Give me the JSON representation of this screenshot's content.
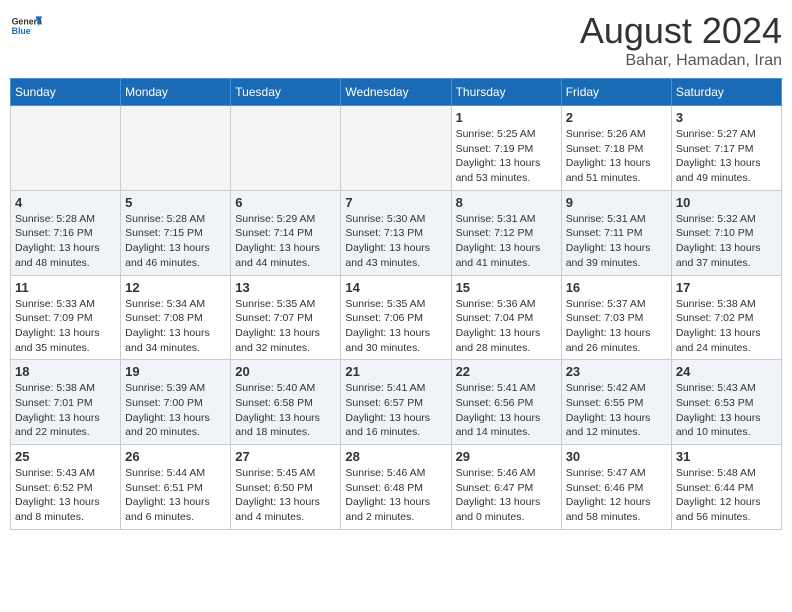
{
  "header": {
    "logo_general": "General",
    "logo_blue": "Blue",
    "month_title": "August 2024",
    "location": "Bahar, Hamadan, Iran"
  },
  "weekdays": [
    "Sunday",
    "Monday",
    "Tuesday",
    "Wednesday",
    "Thursday",
    "Friday",
    "Saturday"
  ],
  "weeks": [
    {
      "days": [
        {
          "num": "",
          "info": ""
        },
        {
          "num": "",
          "info": ""
        },
        {
          "num": "",
          "info": ""
        },
        {
          "num": "",
          "info": ""
        },
        {
          "num": "1",
          "info": "Sunrise: 5:25 AM\nSunset: 7:19 PM\nDaylight: 13 hours\nand 53 minutes."
        },
        {
          "num": "2",
          "info": "Sunrise: 5:26 AM\nSunset: 7:18 PM\nDaylight: 13 hours\nand 51 minutes."
        },
        {
          "num": "3",
          "info": "Sunrise: 5:27 AM\nSunset: 7:17 PM\nDaylight: 13 hours\nand 49 minutes."
        }
      ]
    },
    {
      "days": [
        {
          "num": "4",
          "info": "Sunrise: 5:28 AM\nSunset: 7:16 PM\nDaylight: 13 hours\nand 48 minutes."
        },
        {
          "num": "5",
          "info": "Sunrise: 5:28 AM\nSunset: 7:15 PM\nDaylight: 13 hours\nand 46 minutes."
        },
        {
          "num": "6",
          "info": "Sunrise: 5:29 AM\nSunset: 7:14 PM\nDaylight: 13 hours\nand 44 minutes."
        },
        {
          "num": "7",
          "info": "Sunrise: 5:30 AM\nSunset: 7:13 PM\nDaylight: 13 hours\nand 43 minutes."
        },
        {
          "num": "8",
          "info": "Sunrise: 5:31 AM\nSunset: 7:12 PM\nDaylight: 13 hours\nand 41 minutes."
        },
        {
          "num": "9",
          "info": "Sunrise: 5:31 AM\nSunset: 7:11 PM\nDaylight: 13 hours\nand 39 minutes."
        },
        {
          "num": "10",
          "info": "Sunrise: 5:32 AM\nSunset: 7:10 PM\nDaylight: 13 hours\nand 37 minutes."
        }
      ]
    },
    {
      "days": [
        {
          "num": "11",
          "info": "Sunrise: 5:33 AM\nSunset: 7:09 PM\nDaylight: 13 hours\nand 35 minutes."
        },
        {
          "num": "12",
          "info": "Sunrise: 5:34 AM\nSunset: 7:08 PM\nDaylight: 13 hours\nand 34 minutes."
        },
        {
          "num": "13",
          "info": "Sunrise: 5:35 AM\nSunset: 7:07 PM\nDaylight: 13 hours\nand 32 minutes."
        },
        {
          "num": "14",
          "info": "Sunrise: 5:35 AM\nSunset: 7:06 PM\nDaylight: 13 hours\nand 30 minutes."
        },
        {
          "num": "15",
          "info": "Sunrise: 5:36 AM\nSunset: 7:04 PM\nDaylight: 13 hours\nand 28 minutes."
        },
        {
          "num": "16",
          "info": "Sunrise: 5:37 AM\nSunset: 7:03 PM\nDaylight: 13 hours\nand 26 minutes."
        },
        {
          "num": "17",
          "info": "Sunrise: 5:38 AM\nSunset: 7:02 PM\nDaylight: 13 hours\nand 24 minutes."
        }
      ]
    },
    {
      "days": [
        {
          "num": "18",
          "info": "Sunrise: 5:38 AM\nSunset: 7:01 PM\nDaylight: 13 hours\nand 22 minutes."
        },
        {
          "num": "19",
          "info": "Sunrise: 5:39 AM\nSunset: 7:00 PM\nDaylight: 13 hours\nand 20 minutes."
        },
        {
          "num": "20",
          "info": "Sunrise: 5:40 AM\nSunset: 6:58 PM\nDaylight: 13 hours\nand 18 minutes."
        },
        {
          "num": "21",
          "info": "Sunrise: 5:41 AM\nSunset: 6:57 PM\nDaylight: 13 hours\nand 16 minutes."
        },
        {
          "num": "22",
          "info": "Sunrise: 5:41 AM\nSunset: 6:56 PM\nDaylight: 13 hours\nand 14 minutes."
        },
        {
          "num": "23",
          "info": "Sunrise: 5:42 AM\nSunset: 6:55 PM\nDaylight: 13 hours\nand 12 minutes."
        },
        {
          "num": "24",
          "info": "Sunrise: 5:43 AM\nSunset: 6:53 PM\nDaylight: 13 hours\nand 10 minutes."
        }
      ]
    },
    {
      "days": [
        {
          "num": "25",
          "info": "Sunrise: 5:43 AM\nSunset: 6:52 PM\nDaylight: 13 hours\nand 8 minutes."
        },
        {
          "num": "26",
          "info": "Sunrise: 5:44 AM\nSunset: 6:51 PM\nDaylight: 13 hours\nand 6 minutes."
        },
        {
          "num": "27",
          "info": "Sunrise: 5:45 AM\nSunset: 6:50 PM\nDaylight: 13 hours\nand 4 minutes."
        },
        {
          "num": "28",
          "info": "Sunrise: 5:46 AM\nSunset: 6:48 PM\nDaylight: 13 hours\nand 2 minutes."
        },
        {
          "num": "29",
          "info": "Sunrise: 5:46 AM\nSunset: 6:47 PM\nDaylight: 13 hours\nand 0 minutes."
        },
        {
          "num": "30",
          "info": "Sunrise: 5:47 AM\nSunset: 6:46 PM\nDaylight: 12 hours\nand 58 minutes."
        },
        {
          "num": "31",
          "info": "Sunrise: 5:48 AM\nSunset: 6:44 PM\nDaylight: 12 hours\nand 56 minutes."
        }
      ]
    }
  ]
}
